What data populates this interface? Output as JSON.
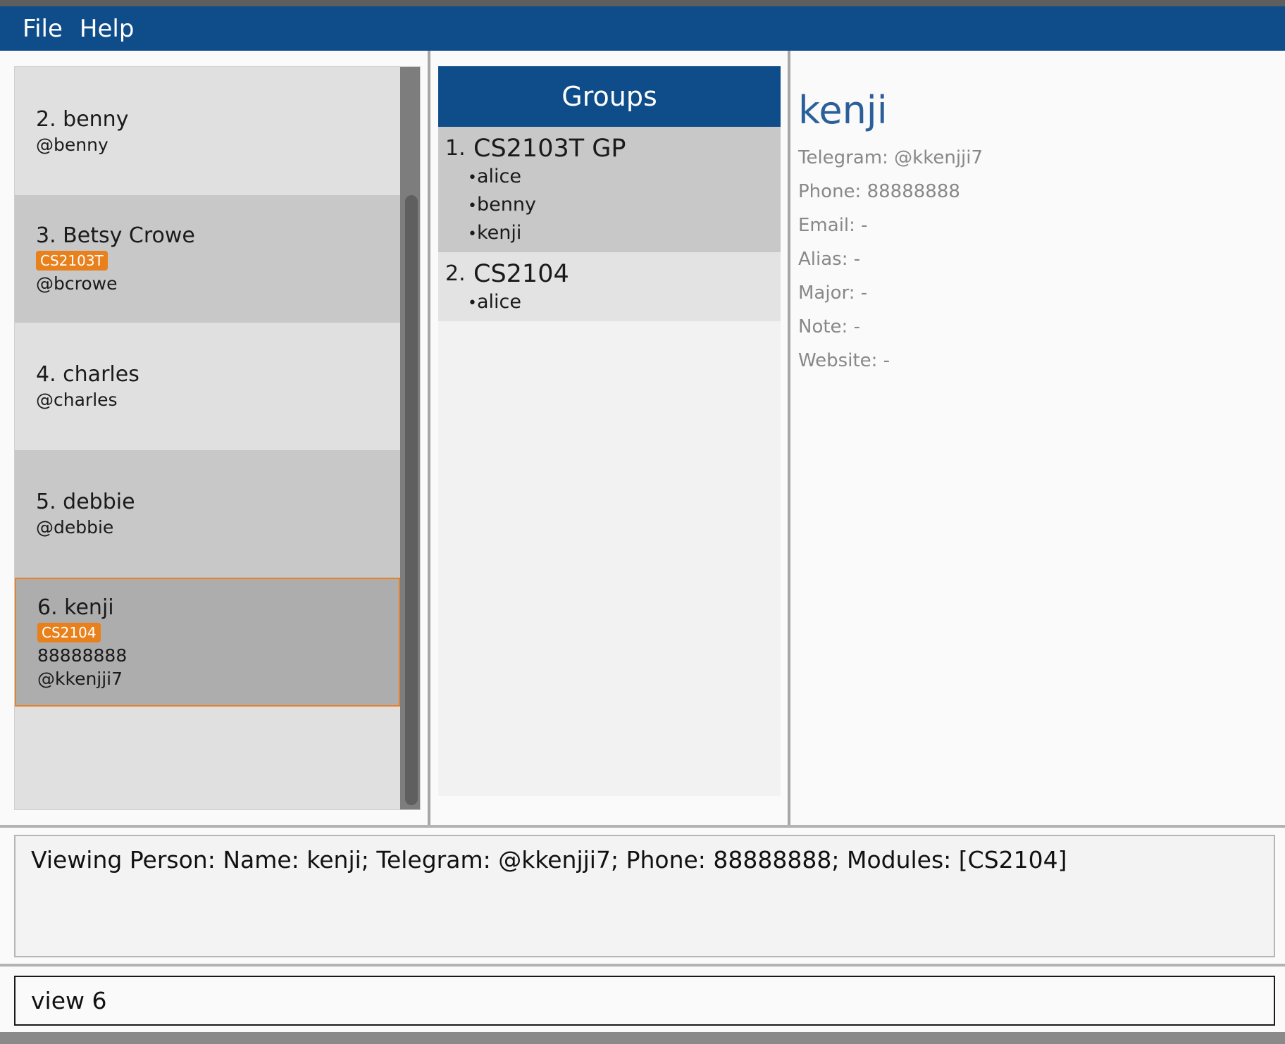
{
  "menu": {
    "file": "File",
    "help": "Help"
  },
  "persons": [
    {
      "index": "2.",
      "name": "benny",
      "tags": [],
      "lines": [
        "@benny"
      ]
    },
    {
      "index": "3.",
      "name": "Betsy Crowe",
      "tags": [
        "CS2103T"
      ],
      "lines": [
        "@bcrowe"
      ]
    },
    {
      "index": "4.",
      "name": "charles",
      "tags": [],
      "lines": [
        "@charles"
      ]
    },
    {
      "index": "5.",
      "name": "debbie",
      "tags": [],
      "lines": [
        "@debbie"
      ]
    },
    {
      "index": "6.",
      "name": "kenji",
      "tags": [
        "CS2104"
      ],
      "lines": [
        "88888888",
        "@kkenjji7"
      ]
    }
  ],
  "groups": {
    "header": "Groups",
    "items": [
      {
        "index": "1.",
        "title": "CS2103T GP",
        "members": [
          "alice",
          "benny",
          "kenji"
        ]
      },
      {
        "index": "2.",
        "title": "CS2104",
        "members": [
          "alice"
        ]
      }
    ]
  },
  "details": {
    "name": "kenji",
    "telegram": "Telegram: @kkenjji7",
    "phone": "Phone: 88888888",
    "email": "Email: -",
    "alias": "Alias: -",
    "major": "Major: -",
    "note": "Note: -",
    "website": "Website: -"
  },
  "result": "Viewing Person: Name: kenji; Telegram: @kkenjji7; Phone: 88888888; Modules: [CS2104]",
  "command": {
    "value": "view 6"
  },
  "colors": {
    "accent": "#0f4c8a",
    "tag": "#e8801c",
    "selected_border": "#e8812a",
    "detail_name": "#2c5f9a"
  }
}
